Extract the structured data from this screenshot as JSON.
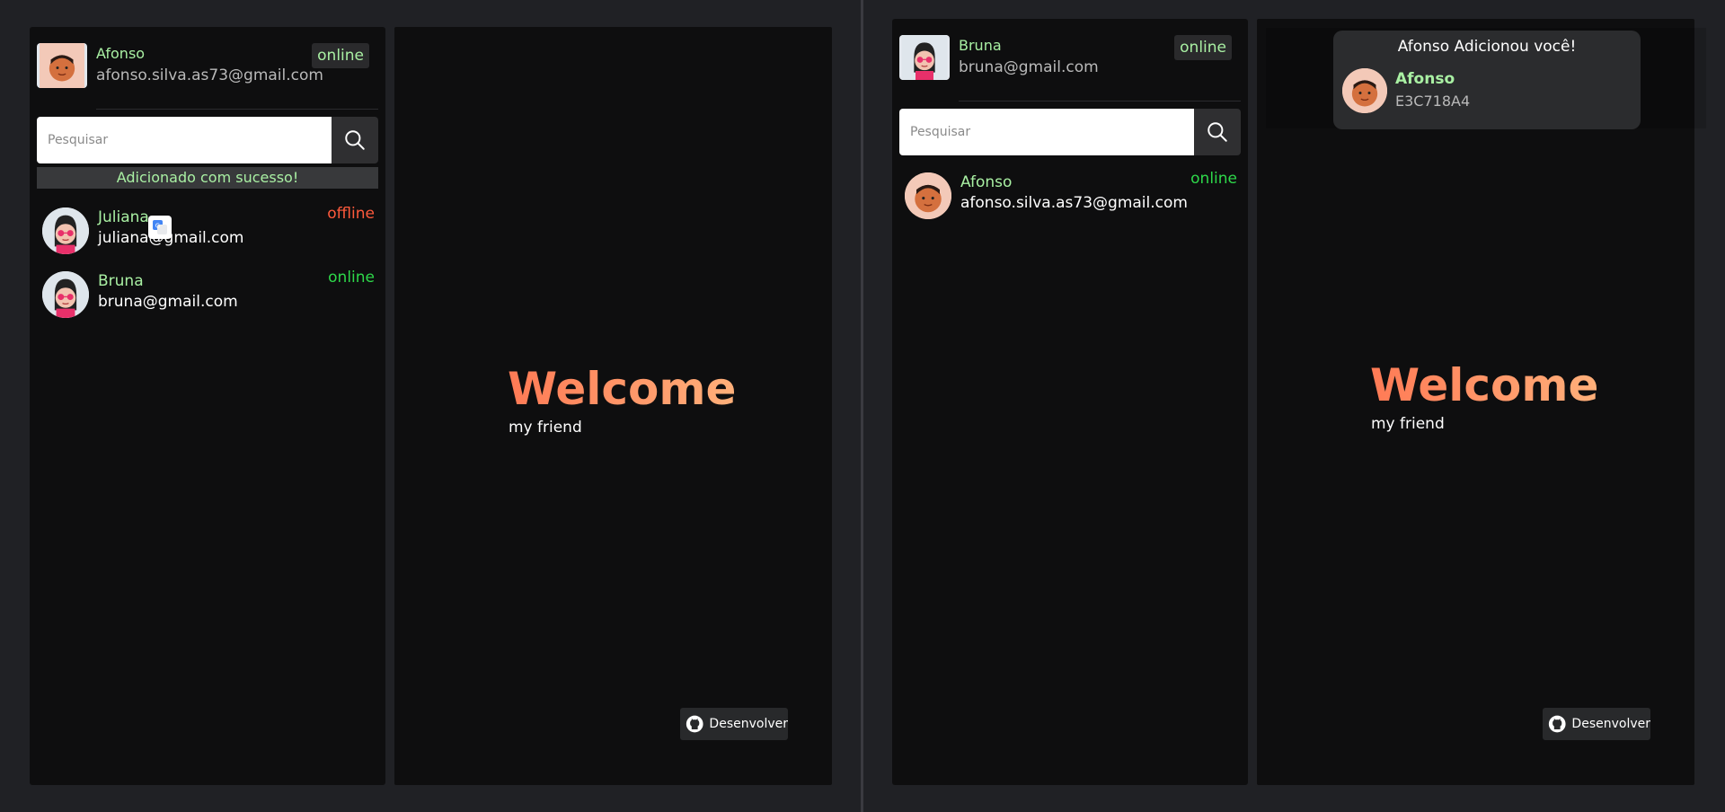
{
  "left": {
    "profile": {
      "name": "Afonso",
      "email": "afonso.silva.as73@gmail.com",
      "status": "online"
    },
    "search": {
      "placeholder": "Pesquisar"
    },
    "success_message": "Adicionado com sucesso!",
    "contacts": [
      {
        "name": "Juliana",
        "email": "juliana@gmail.com",
        "status": "offline"
      },
      {
        "name": "Bruna",
        "email": "bruna@gmail.com",
        "status": "online"
      }
    ],
    "welcome": {
      "title": "Welcome",
      "subtitle": "my friend"
    },
    "github_button": "Desenvolver"
  },
  "right": {
    "profile": {
      "name": "Bruna",
      "email": "bruna@gmail.com",
      "status": "online"
    },
    "search": {
      "placeholder": "Pesquisar"
    },
    "contacts": [
      {
        "name": "Afonso",
        "email": "afonso.silva.as73@gmail.com",
        "status": "online"
      }
    ],
    "notification": {
      "title": "Afonso Adicionou você!",
      "name": "Afonso",
      "code": "E3C718A4"
    },
    "welcome": {
      "title": "Welcome",
      "subtitle": "my friend"
    },
    "github_button": "Desenvolver"
  },
  "colors": {
    "accent": "#a9f0a3",
    "online": "#2ed84a",
    "offline": "#ff5a3c",
    "welcome": "#ff8a60"
  },
  "icons": [
    "search-icon",
    "github-icon",
    "google-translate-icon"
  ]
}
